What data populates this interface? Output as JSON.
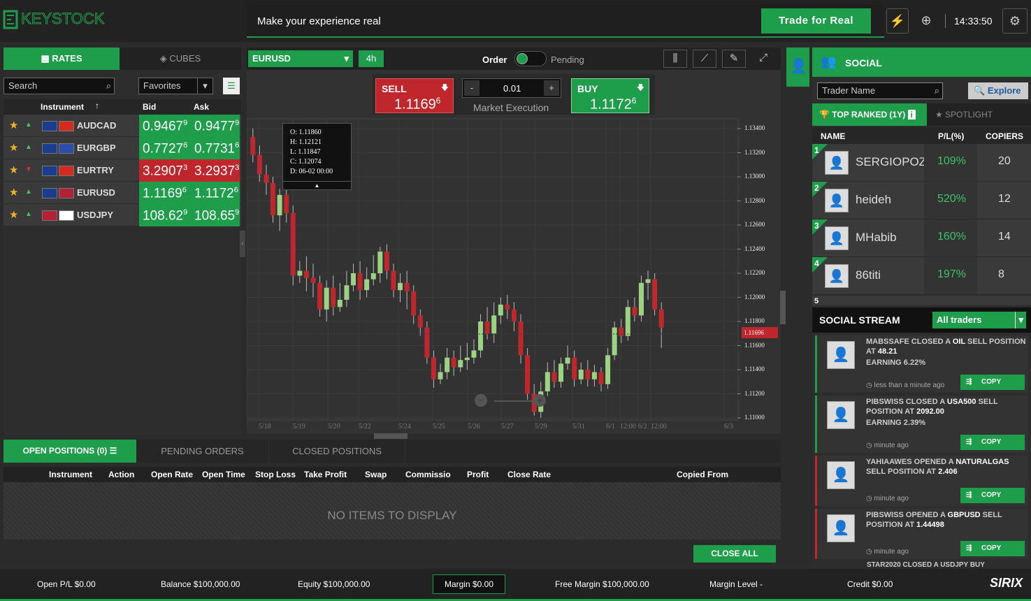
{
  "topbar": {
    "banner_text": "Make your experience real",
    "trade_real": "Trade for Real",
    "clock": "14:33:50"
  },
  "left": {
    "tabs": [
      {
        "label": "RATES"
      },
      {
        "label": "CUBES"
      }
    ],
    "search_placeholder": "Search",
    "favorites": "Favorites",
    "headers": {
      "instrument": "Instrument",
      "bid": "Bid",
      "ask": "Ask"
    },
    "rates": [
      {
        "symbol": "AUDCAD",
        "bid": "0.9467",
        "bid_sup": "9",
        "ask": "0.9477",
        "ask_sup": "9",
        "color": "#1e9e4a",
        "dir": "up"
      },
      {
        "symbol": "EURGBP",
        "bid": "0.7727",
        "bid_sup": "6",
        "ask": "0.7731",
        "ask_sup": "6",
        "color": "#1e9e4a",
        "dir": "up"
      },
      {
        "symbol": "EURTRY",
        "bid": "3.2907",
        "bid_sup": "3",
        "ask": "3.2937",
        "ask_sup": "3",
        "color": "#c0272d",
        "dir": "down"
      },
      {
        "symbol": "EURUSD",
        "bid": "1.1169",
        "bid_sup": "6",
        "ask": "1.1172",
        "ask_sup": "6",
        "color": "#1e9e4a",
        "dir": "up"
      },
      {
        "symbol": "USDJPY",
        "bid": "108.62",
        "bid_sup": "9",
        "ask": "108.65",
        "ask_sup": "9",
        "color": "#1e9e4a",
        "dir": "up"
      }
    ]
  },
  "chart_top": {
    "symbol": "EURUSD",
    "timeframe": "4h",
    "order": "Order",
    "pending": "Pending"
  },
  "trade": {
    "sell_label": "SELL",
    "sell_price": "1.1169",
    "sell_sup": "6",
    "buy_label": "BUY",
    "buy_price": "1.1172",
    "buy_sup": "6",
    "minus": "-",
    "plus": "+",
    "qty": "0.01",
    "execution": "Market Execution"
  },
  "ohlc": {
    "o": "O:  1.11860",
    "h": "H:  1.12121",
    "l": "L:  1.11847",
    "c": "C:  1.12074",
    "d": "D:  06-02 00:00"
  },
  "chart_data": {
    "type": "candlestick",
    "y_ticks": [
      "1.13400",
      "1.13200",
      "1.13000",
      "1.12800",
      "1.12600",
      "1.12400",
      "1.12200",
      "1.12000",
      "1.11800",
      "1.11600",
      "1.11400",
      "1.11200",
      "1.11000"
    ],
    "ylim": [
      1.11,
      1.134
    ],
    "current_price": "1.11696",
    "x_ticks": [
      "5/18",
      "5/19",
      "5/20",
      "5/22",
      "5/24",
      "5/25",
      "5/26",
      "5/27",
      "5/29",
      "5/31",
      "6/1",
      "12:00",
      "6/2",
      "12:00",
      "6/3"
    ],
    "candles": [
      [
        1.1333,
        1.1318,
        1.134,
        1.1312
      ],
      [
        1.1318,
        1.1302,
        1.1326,
        1.1296
      ],
      [
        1.1302,
        1.1295,
        1.131,
        1.1285
      ],
      [
        1.1295,
        1.1268,
        1.13,
        1.1262
      ],
      [
        1.1268,
        1.1285,
        1.129,
        1.1255
      ],
      [
        1.1285,
        1.127,
        1.1296,
        1.1262
      ],
      [
        1.127,
        1.1218,
        1.1276,
        1.121
      ],
      [
        1.1218,
        1.1222,
        1.123,
        1.1212
      ],
      [
        1.1222,
        1.1216,
        1.1234,
        1.1205
      ],
      [
        1.1216,
        1.1212,
        1.1228,
        1.12
      ],
      [
        1.1212,
        1.119,
        1.1218,
        1.1184
      ],
      [
        1.119,
        1.1208,
        1.1214,
        1.118
      ],
      [
        1.1208,
        1.1192,
        1.1218,
        1.1185
      ],
      [
        1.1192,
        1.1198,
        1.1212,
        1.1188
      ],
      [
        1.1198,
        1.121,
        1.1222,
        1.1192
      ],
      [
        1.121,
        1.122,
        1.1228,
        1.1205
      ],
      [
        1.122,
        1.1206,
        1.123,
        1.1198
      ],
      [
        1.1206,
        1.1215,
        1.1225,
        1.12
      ],
      [
        1.1215,
        1.122,
        1.1235,
        1.121
      ],
      [
        1.122,
        1.1238,
        1.1242,
        1.1212
      ],
      [
        1.1238,
        1.1222,
        1.1244,
        1.1215
      ],
      [
        1.1222,
        1.1206,
        1.1228,
        1.12
      ],
      [
        1.1206,
        1.1212,
        1.122,
        1.1196
      ],
      [
        1.1212,
        1.1205,
        1.1222,
        1.119
      ],
      [
        1.1205,
        1.1185,
        1.121,
        1.1178
      ],
      [
        1.1185,
        1.1175,
        1.119,
        1.1168
      ],
      [
        1.1175,
        1.115,
        1.118,
        1.1145
      ],
      [
        1.115,
        1.1132,
        1.1156,
        1.1125
      ],
      [
        1.1132,
        1.1138,
        1.1145,
        1.1128
      ],
      [
        1.1138,
        1.115,
        1.1158,
        1.1132
      ],
      [
        1.115,
        1.1142,
        1.1156,
        1.1135
      ],
      [
        1.1142,
        1.1148,
        1.116,
        1.1138
      ],
      [
        1.1148,
        1.115,
        1.1162,
        1.114
      ],
      [
        1.115,
        1.1156,
        1.1165,
        1.1145
      ],
      [
        1.1156,
        1.118,
        1.1186,
        1.115
      ],
      [
        1.118,
        1.117,
        1.1192,
        1.1165
      ],
      [
        1.117,
        1.1185,
        1.1196,
        1.1162
      ],
      [
        1.1185,
        1.1194,
        1.12,
        1.1178
      ],
      [
        1.1194,
        1.119,
        1.1202,
        1.1182
      ],
      [
        1.119,
        1.118,
        1.1196,
        1.1172
      ],
      [
        1.118,
        1.1152,
        1.1186,
        1.1145
      ],
      [
        1.1152,
        1.112,
        1.1158,
        1.1115
      ],
      [
        1.112,
        1.1105,
        1.1128,
        1.1102
      ],
      [
        1.1105,
        1.1122,
        1.113,
        1.11
      ],
      [
        1.1122,
        1.1138,
        1.1146,
        1.1118
      ],
      [
        1.1138,
        1.113,
        1.1148,
        1.1125
      ],
      [
        1.113,
        1.1145,
        1.115,
        1.1125
      ],
      [
        1.1145,
        1.115,
        1.116,
        1.114
      ],
      [
        1.115,
        1.1132,
        1.1156,
        1.1126
      ],
      [
        1.1132,
        1.114,
        1.1146,
        1.1128
      ],
      [
        1.114,
        1.1132,
        1.1148,
        1.1126
      ],
      [
        1.1132,
        1.1138,
        1.1144,
        1.1126
      ],
      [
        1.1138,
        1.1128,
        1.1142,
        1.1122
      ],
      [
        1.1128,
        1.1152,
        1.1158,
        1.1124
      ],
      [
        1.1152,
        1.1175,
        1.118,
        1.1148
      ],
      [
        1.1175,
        1.1168,
        1.1182,
        1.1162
      ],
      [
        1.1168,
        1.1192,
        1.1198,
        1.1164
      ],
      [
        1.1192,
        1.1185,
        1.12,
        1.118
      ],
      [
        1.1185,
        1.1212,
        1.1218,
        1.118
      ],
      [
        1.1212,
        1.1215,
        1.1222,
        1.1198
      ],
      [
        1.1215,
        1.119,
        1.122,
        1.1185
      ],
      [
        1.119,
        1.1175,
        1.1196,
        1.1158
      ]
    ],
    "xlabel": "",
    "ylabel": ""
  },
  "bottom": {
    "tabs": [
      {
        "label": "OPEN POSITIONS (0)"
      },
      {
        "label": "PENDING ORDERS"
      },
      {
        "label": "CLOSED POSITIONS"
      }
    ],
    "columns": [
      "Instrument",
      "Action",
      "Open Rate",
      "Open Time",
      "Stop Loss",
      "Take Profit",
      "Swap",
      "Commissio",
      "Profit",
      "Close Rate",
      "Copied From"
    ],
    "empty": "NO ITEMS TO DISPLAY",
    "close_all": "CLOSE ALL"
  },
  "status": {
    "open_pl": "Open P/L $0.00",
    "balance": "Balance $100,000.00",
    "equity": "Equity $100,000.00",
    "margin": "Margin $0.00",
    "free_margin": "Free Margin $100,000.00",
    "margin_level": "Margin Level -",
    "credit": "Credit $0.00",
    "brand": "SIRIX"
  },
  "social": {
    "title": "SOCIAL",
    "trader_placeholder": "Trader Name",
    "explore": "Explore",
    "tabs": [
      {
        "label": "TOP RANKED (1Y)"
      },
      {
        "label": "SPOTLIGHT"
      }
    ],
    "headers": {
      "name": "NAME",
      "pl": "P/L(%)",
      "copiers": "COPIERS"
    },
    "traders": [
      {
        "rank": "1",
        "name": "SERGIOPOZZ",
        "pl": "109%",
        "copiers": "20"
      },
      {
        "rank": "2",
        "name": "heideh",
        "pl": "520%",
        "copiers": "12"
      },
      {
        "rank": "3",
        "name": "MHabib",
        "pl": "160%",
        "copiers": "14"
      },
      {
        "rank": "4",
        "name": "86titi",
        "pl": "197%",
        "copiers": "8"
      }
    ],
    "rank5": "5",
    "stream_title": "SOCIAL STREAM",
    "stream_filter": "All traders",
    "stream": [
      {
        "l1": "MABSSAFE CLOSED A ",
        "b1": "OIL",
        "l2": " SELL POSITION AT ",
        "b2": "48.21",
        "earn": "EARNING 6.22%",
        "ago": "less than a minute ago",
        "copy": "COPY",
        "border": "#1e9e4a"
      },
      {
        "l1": "PIBSWISS CLOSED A ",
        "b1": "USA500",
        "l2": " SELL POSITION AT ",
        "b2": "2092.00",
        "earn": "EARNING 2.39%",
        "ago": "minute ago",
        "copy": "COPY",
        "border": "#1e9e4a"
      },
      {
        "l1": "YAHIAAWES OPENED A ",
        "b1": "NATURALGAS",
        "l2": " SELL POSITION AT ",
        "b2": "2.406",
        "earn": "",
        "ago": "minute ago",
        "copy": "COPY",
        "border": "#c0272d"
      },
      {
        "l1": "PIBSWISS OPENED A ",
        "b1": "GBPUSD",
        "l2": " SELL POSITION AT ",
        "b2": "1.44498",
        "earn": "",
        "ago": "minute ago",
        "copy": "COPY",
        "border": "#c0272d"
      }
    ],
    "stream_tail": "STAR2020 CLOSED A USDJPY BUY"
  }
}
